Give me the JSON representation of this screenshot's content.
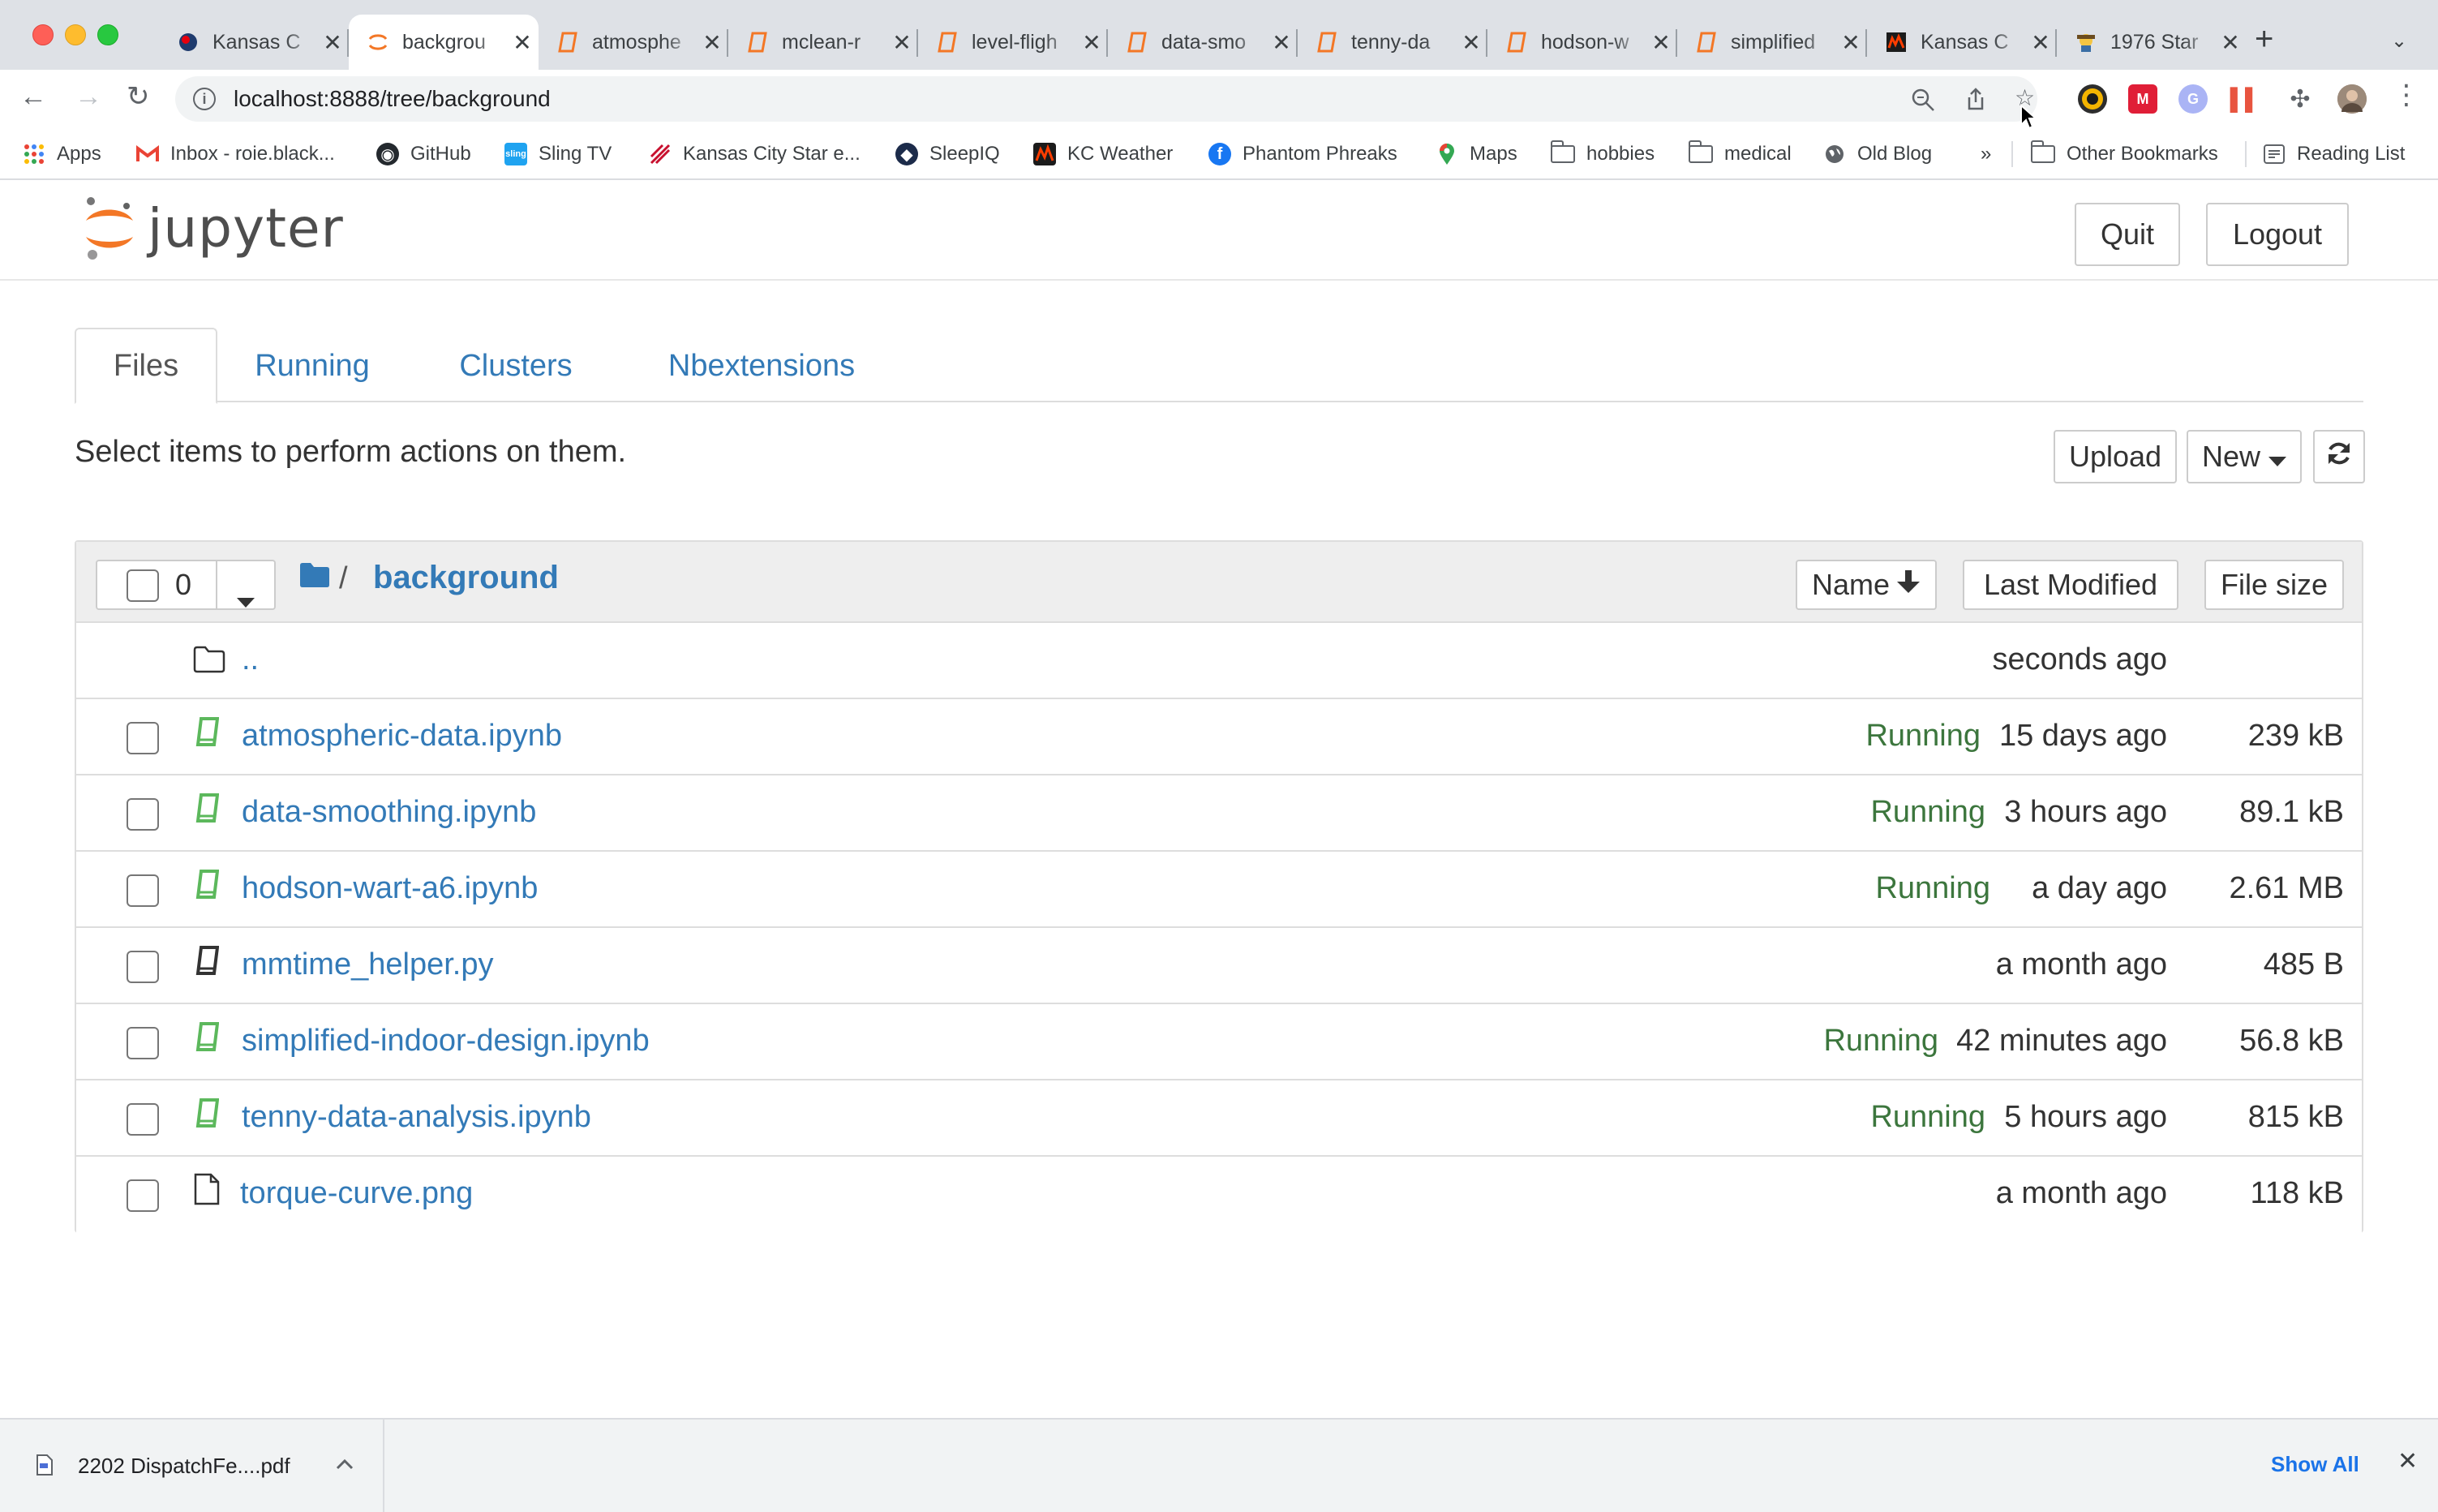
{
  "browser": {
    "tabs": [
      {
        "title": "Kansas C",
        "favicon": "kansas-icon"
      },
      {
        "title": "backgrou",
        "favicon": "jupyter-icon",
        "active": true
      },
      {
        "title": "atmosphe",
        "favicon": "notebook-icon"
      },
      {
        "title": "mclean-r",
        "favicon": "notebook-icon"
      },
      {
        "title": "level-fligh",
        "favicon": "notebook-icon"
      },
      {
        "title": "data-smo",
        "favicon": "notebook-icon"
      },
      {
        "title": "tenny-da",
        "favicon": "notebook-icon"
      },
      {
        "title": "hodson-w",
        "favicon": "notebook-icon"
      },
      {
        "title": "simplified",
        "favicon": "notebook-icon"
      },
      {
        "title": "Kansas C",
        "favicon": "weather-icon"
      },
      {
        "title": "1976 Star",
        "favicon": "star-icon"
      }
    ],
    "url": "localhost:8888/tree/background",
    "bookmarks": [
      {
        "label": "Apps"
      },
      {
        "label": "Inbox - roie.black..."
      },
      {
        "label": "GitHub"
      },
      {
        "label": "Sling TV"
      },
      {
        "label": "Kansas City Star e..."
      },
      {
        "label": "SleepIQ"
      },
      {
        "label": "KC Weather"
      },
      {
        "label": "Phantom Phreaks"
      },
      {
        "label": "Maps"
      },
      {
        "label": "hobbies"
      },
      {
        "label": "medical"
      },
      {
        "label": "Old Blog"
      }
    ],
    "bookmarks_overflow": "»",
    "other_bookmarks": "Other Bookmarks",
    "reading_list": "Reading List"
  },
  "jupyter": {
    "logo_text": "jupyter",
    "quit_label": "Quit",
    "logout_label": "Logout",
    "tabs": [
      "Files",
      "Running",
      "Clusters",
      "Nbextensions"
    ],
    "select_message": "Select items to perform actions on them.",
    "upload_label": "Upload",
    "new_label": "New",
    "selected_count": "0",
    "breadcrumb_sep": "/",
    "current_folder": "background",
    "sort_name_label": "Name",
    "last_modified_label": "Last Modified",
    "file_size_label": "File size",
    "parent": {
      "name": "..",
      "modified": "seconds ago"
    },
    "files": [
      {
        "name": "atmospheric-data.ipynb",
        "type": "notebook",
        "status": "Running",
        "modified": "15 days ago",
        "size": "239 kB"
      },
      {
        "name": "data-smoothing.ipynb",
        "type": "notebook",
        "status": "Running",
        "modified": "3 hours ago",
        "size": "89.1 kB"
      },
      {
        "name": "hodson-wart-a6.ipynb",
        "type": "notebook",
        "status": "Running",
        "modified": "a day ago",
        "size": "2.61 MB"
      },
      {
        "name": "mmtime_helper.py",
        "type": "file",
        "status": "",
        "modified": "a month ago",
        "size": "485 B"
      },
      {
        "name": "simplified-indoor-design.ipynb",
        "type": "notebook",
        "status": "Running",
        "modified": "42 minutes ago",
        "size": "56.8 kB"
      },
      {
        "name": "tenny-data-analysis.ipynb",
        "type": "notebook",
        "status": "Running",
        "modified": "5 hours ago",
        "size": "815 kB"
      },
      {
        "name": "torque-curve.png",
        "type": "image",
        "status": "",
        "modified": "a month ago",
        "size": "118 kB"
      }
    ]
  },
  "download_bar": {
    "filename": "2202 DispatchFe....pdf",
    "show_all": "Show All"
  },
  "colors": {
    "link": "#337ab7",
    "running": "#3c763d",
    "notebook_icon": "#5cb85c",
    "jupyter_orange": "#f37726"
  }
}
